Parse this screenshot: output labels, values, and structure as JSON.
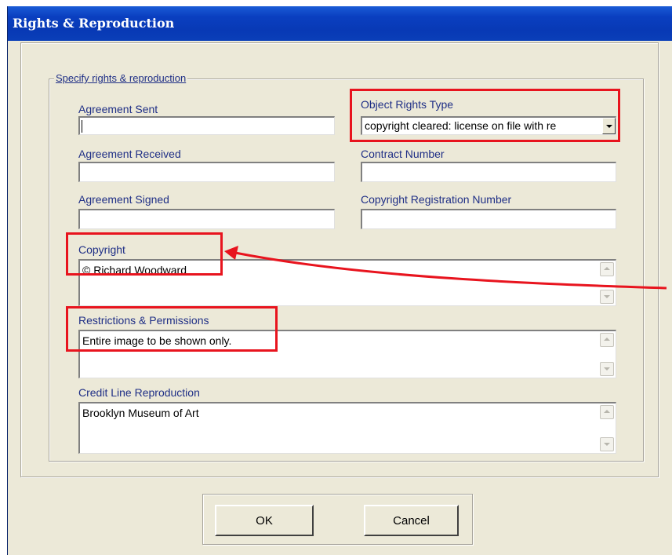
{
  "window": {
    "title": "Rights & Reproduction"
  },
  "group": {
    "legend": "Specify rights & reproduction"
  },
  "fields": {
    "agreement_sent": {
      "label": "Agreement Sent",
      "value": ""
    },
    "agreement_received": {
      "label": "Agreement Received",
      "value": ""
    },
    "agreement_signed": {
      "label": "Agreement Signed",
      "value": ""
    },
    "object_rights_type": {
      "label": "Object Rights Type",
      "value": "copyright cleared: license on file with re"
    },
    "contract_number": {
      "label": "Contract Number",
      "value": ""
    },
    "copyright_registration_number": {
      "label": "Copyright Registration Number",
      "value": ""
    },
    "copyright": {
      "label": "Copyright",
      "value": "© Richard Woodward"
    },
    "restrictions_permissions": {
      "label": "Restrictions & Permissions",
      "value": "Entire image to be shown only."
    },
    "credit_line_reproduction": {
      "label": "Credit Line Reproduction",
      "value": "Brooklyn Museum of Art"
    }
  },
  "buttons": {
    "ok": "OK",
    "cancel": "Cancel"
  },
  "annotations": {
    "highlight_color": "#e8141e"
  }
}
